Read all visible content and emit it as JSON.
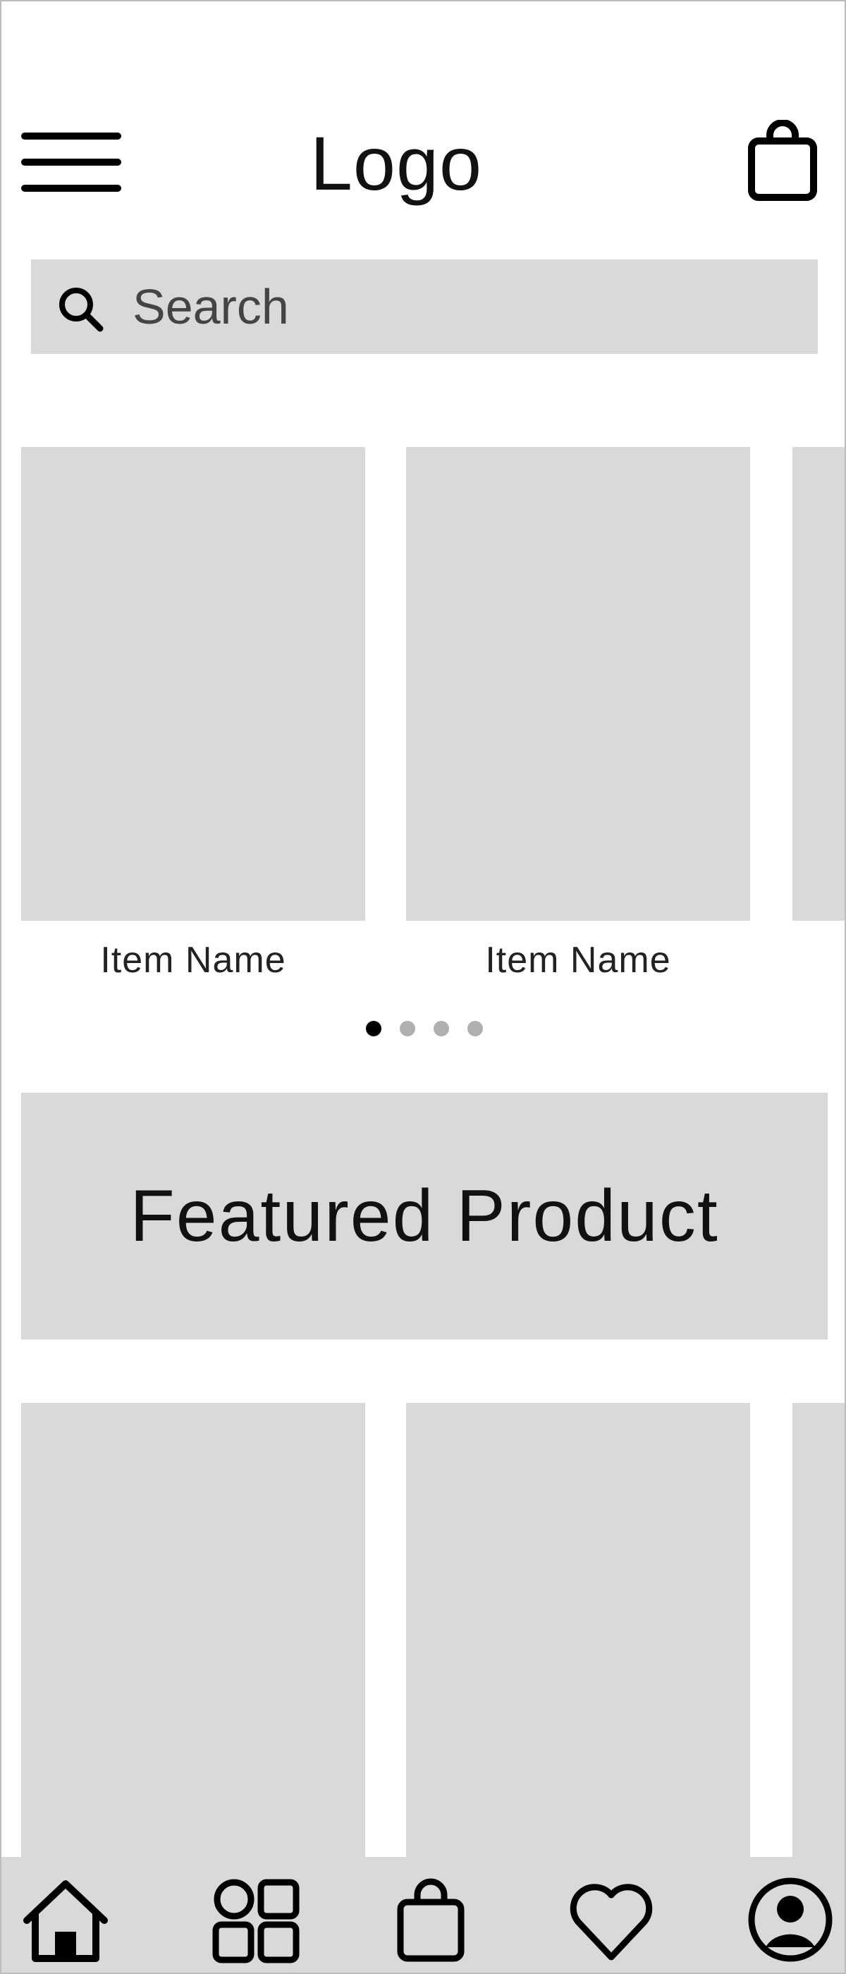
{
  "header": {
    "menu_icon": "hamburger-icon",
    "logo": "Logo",
    "cart_icon": "shopping-bag-icon"
  },
  "search": {
    "icon": "search-icon",
    "placeholder": "Search",
    "value": ""
  },
  "carousel": {
    "items": [
      {
        "label": "Item Name"
      },
      {
        "label": "Item Name"
      },
      {
        "label": ""
      }
    ],
    "pagination": {
      "total": 4,
      "active": 1
    }
  },
  "featured": {
    "label": "Featured Product"
  },
  "product_grid": {
    "items": [
      {},
      {},
      {}
    ]
  },
  "bottom_nav": {
    "items": [
      {
        "icon": "home-icon"
      },
      {
        "icon": "categories-grid-icon"
      },
      {
        "icon": "shopping-bag-icon"
      },
      {
        "icon": "heart-icon"
      },
      {
        "icon": "profile-icon"
      }
    ]
  },
  "colors": {
    "placeholder_gray": "#d9d9d9",
    "text": "#111111",
    "dot_active": "#000000",
    "dot_inactive": "#b0b0b0"
  }
}
